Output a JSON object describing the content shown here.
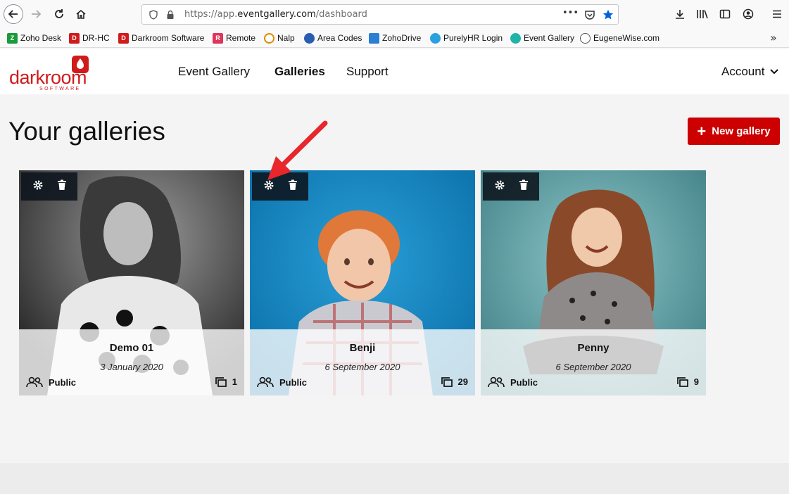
{
  "browser": {
    "url_prefix": "https://app.",
    "url_host": "eventgallery.com",
    "url_path": "/dashboard",
    "url_more": "•••"
  },
  "bookmarks": {
    "items": [
      {
        "label": "Zoho Desk",
        "color": "#1a9b3a"
      },
      {
        "label": "DR-HC",
        "color": "#d01b1b"
      },
      {
        "label": "Darkroom Software",
        "color": "#d01b1b"
      },
      {
        "label": "Remote",
        "color": "#e0345a"
      },
      {
        "label": "Nalp",
        "color": "#e08a00"
      },
      {
        "label": "Area Codes",
        "color": "#2a5db0"
      },
      {
        "label": "ZohoDrive",
        "color": "#2a7fd4"
      },
      {
        "label": "PurelyHR Login",
        "color": "#2aa0e0"
      },
      {
        "label": "Event Gallery",
        "color": "#1fb3a8"
      },
      {
        "label": "EugeneWise.com",
        "color": "#555555"
      }
    ],
    "more": "»"
  },
  "site": {
    "logo_word": "darkroom",
    "logo_sub": "SOFTWARE",
    "nav": [
      "Event Gallery",
      "Galleries",
      "Support"
    ],
    "account": "Account",
    "brand_color": "#cc0000"
  },
  "page": {
    "title": "Your galleries",
    "new_gallery": "New gallery"
  },
  "galleries": [
    {
      "name": "Demo 01",
      "date": "3 January 2020",
      "visibility": "Public",
      "count": "1"
    },
    {
      "name": "Benji",
      "date": "6 September 2020",
      "visibility": "Public",
      "count": "29"
    },
    {
      "name": "Penny",
      "date": "6 September 2020",
      "visibility": "Public",
      "count": "9"
    }
  ]
}
